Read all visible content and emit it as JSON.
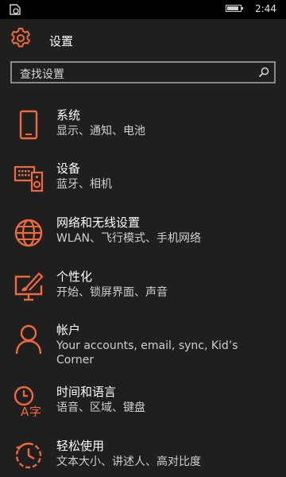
{
  "status_bar": {
    "time": "2:44",
    "battery_level": 0.85
  },
  "header": {
    "title": "设置",
    "icon": "gear-icon"
  },
  "search": {
    "placeholder": "查找设置",
    "icon": "search-icon"
  },
  "colors": {
    "accent": "#ef6a3a",
    "background": "#1f1f1f",
    "statusbar": "#000000"
  },
  "items": [
    {
      "label": "系统",
      "sub": "显示、通知、电池",
      "icon": "phone-icon"
    },
    {
      "label": "设备",
      "sub": "蓝牙、相机",
      "icon": "devices-icon"
    },
    {
      "label": "网络和无线设置",
      "sub": "WLAN、飞行模式、手机网络",
      "icon": "globe-icon"
    },
    {
      "label": "个性化",
      "sub": "开始、锁屏界面、声音",
      "icon": "personalization-icon"
    },
    {
      "label": "帐户",
      "sub": "Your accounts, email, sync, Kid’s Corner",
      "icon": "person-icon"
    },
    {
      "label": "时间和语言",
      "sub": "语音、区域、键盘",
      "icon": "time-language-icon"
    },
    {
      "label": "轻松使用",
      "sub": "文本大小、讲述人、高对比度",
      "icon": "ease-of-access-icon"
    }
  ]
}
